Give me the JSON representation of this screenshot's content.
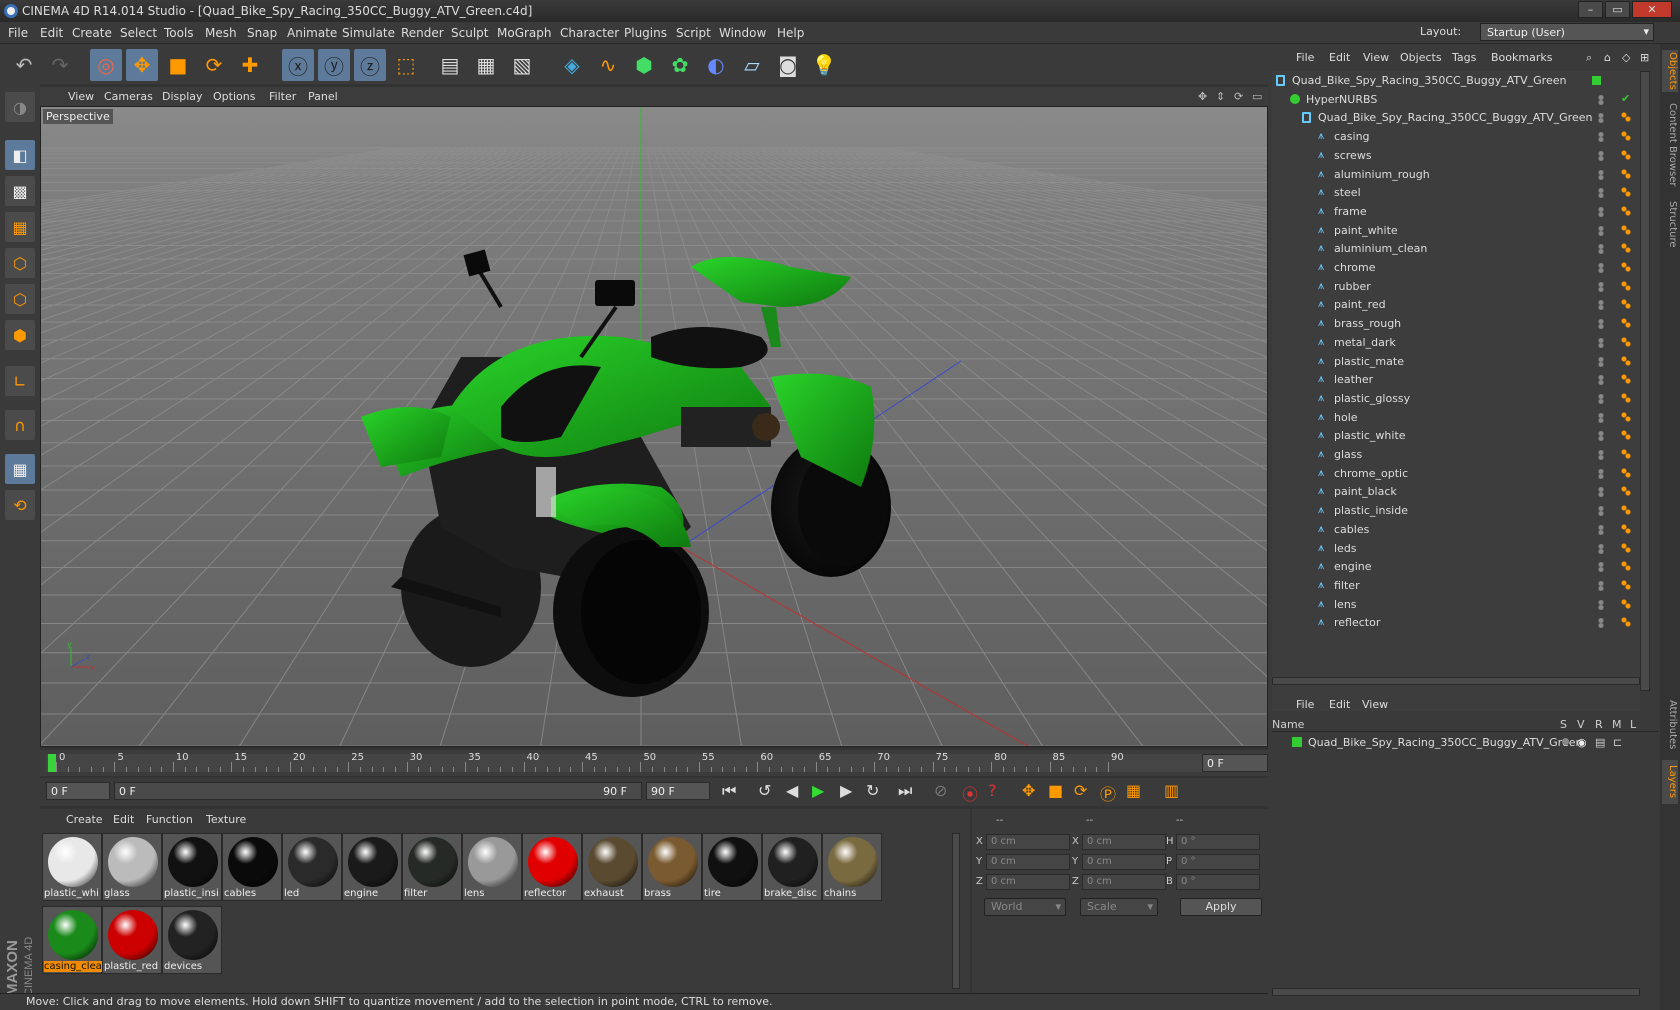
{
  "window": {
    "title": "CINEMA 4D R14.014 Studio - [Quad_Bike_Spy_Racing_350CC_Buggy_ATV_Green.c4d]",
    "min": "–",
    "max": "▭",
    "close": "✕"
  },
  "menu": [
    "File",
    "Edit",
    "Create",
    "Select",
    "Tools",
    "Mesh",
    "Snap",
    "Animate",
    "Simulate",
    "Render",
    "Sculpt",
    "MoGraph",
    "Character",
    "Plugins",
    "Script",
    "Window",
    "Help"
  ],
  "layout": {
    "label": "Layout:",
    "value": "Startup (User)"
  },
  "viewport": {
    "menu": [
      "View",
      "Cameras",
      "Display",
      "Options",
      "Filter",
      "Panel"
    ],
    "label": "Perspective"
  },
  "timeline": {
    "ticks": [
      "0",
      "5",
      "10",
      "15",
      "20",
      "25",
      "30",
      "35",
      "40",
      "45",
      "50",
      "55",
      "60",
      "65",
      "70",
      "75",
      "80",
      "85",
      "90"
    ],
    "frame_field": "0 F"
  },
  "timectrl": {
    "start": "0 F",
    "slider_start": "0 F",
    "slider_end": "90 F",
    "end": "90 F"
  },
  "materials": {
    "menu": [
      "Create",
      "Edit",
      "Function",
      "Texture"
    ],
    "items": [
      {
        "name": "plastic_whi",
        "color": "#e8e8e8"
      },
      {
        "name": "glass",
        "color": "#bbbbbb"
      },
      {
        "name": "plastic_insi",
        "color": "#111111"
      },
      {
        "name": "cables",
        "color": "#0a0a0a"
      },
      {
        "name": "led",
        "color": "#2a2a2a"
      },
      {
        "name": "engine",
        "color": "#1a1a1a"
      },
      {
        "name": "filter",
        "color": "#262a26"
      },
      {
        "name": "lens",
        "color": "#999999"
      },
      {
        "name": "reflector",
        "color": "#e00000"
      },
      {
        "name": "exhaust",
        "color": "#5a4a30"
      },
      {
        "name": "brass",
        "color": "#7a5a30"
      },
      {
        "name": "tire",
        "color": "#101010"
      },
      {
        "name": "brake_disc",
        "color": "#202020"
      },
      {
        "name": "chains",
        "color": "#7a6a40"
      },
      {
        "name": "casing_clea",
        "color": "#1a8a1a"
      },
      {
        "name": "plastic_red",
        "color": "#cc0000"
      },
      {
        "name": "devices",
        "color": "#222222"
      }
    ]
  },
  "coords": {
    "headers": [
      "--",
      "--",
      "--"
    ],
    "rows": [
      {
        "l1": "X",
        "v1": "0 cm",
        "l2": "X",
        "v2": "0 cm",
        "l3": "H",
        "v3": "0 °"
      },
      {
        "l1": "Y",
        "v1": "0 cm",
        "l2": "Y",
        "v2": "0 cm",
        "l3": "P",
        "v3": "0 °"
      },
      {
        "l1": "Z",
        "v1": "0 cm",
        "l2": "Z",
        "v2": "0 cm",
        "l3": "B",
        "v3": "0 °"
      }
    ],
    "world": "World",
    "scale": "Scale",
    "apply": "Apply"
  },
  "status": "Move: Click and drag to move elements. Hold down SHIFT to quantize movement / add to the selection in point mode, CTRL to remove.",
  "maxon": {
    "brand": "MAXON",
    "product": "CINEMA 4D"
  },
  "objects": {
    "menu": [
      "File",
      "Edit",
      "View",
      "Objects",
      "Tags",
      "Bookmarks"
    ],
    "root": "Quad_Bike_Spy_Racing_350CC_Buggy_ATV_Green",
    "nurbs": "HyperNURBS",
    "mesh": "Quad_Bike_Spy_Racing_350CC_Buggy_ATV_Green",
    "children": [
      "casing",
      "screws",
      "aluminium_rough",
      "steel",
      "frame",
      "paint_white",
      "aluminium_clean",
      "chrome",
      "rubber",
      "paint_red",
      "brass_rough",
      "metal_dark",
      "plastic_mate",
      "leather",
      "plastic_glossy",
      "hole",
      "plastic_white",
      "glass",
      "chrome_optic",
      "paint_black",
      "plastic_inside",
      "cables",
      "leds",
      "engine",
      "filter",
      "lens",
      "reflector"
    ]
  },
  "layers": {
    "menu": [
      "File",
      "Edit",
      "View"
    ],
    "headers": {
      "name": "Name",
      "s": "S",
      "v": "V",
      "r": "R",
      "m": "M",
      "l": "L"
    },
    "item": "Quad_Bike_Spy_Racing_350CC_Buggy_ATV_Green"
  },
  "sidetabs": [
    "Objects",
    "Content Browser",
    "Structure",
    "Attributes",
    "Layers"
  ],
  "colors": {
    "accent": "#5d7a9a",
    "layer_green": "#33cc33",
    "selected_orange": "#f08a00",
    "bike_green": "#1a9a1a"
  }
}
